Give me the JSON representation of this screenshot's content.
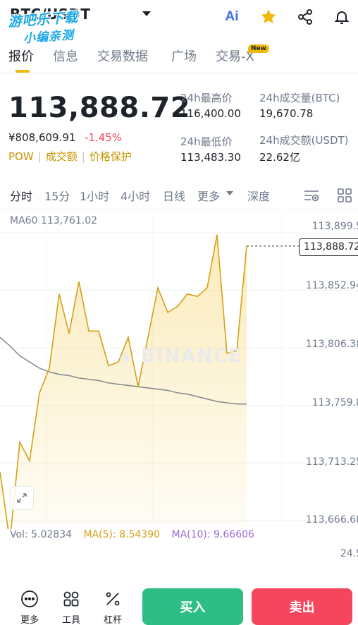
{
  "header": {
    "pair": "BTC/USDT",
    "watermark_line1": "游吧乐下载",
    "watermark_line2": "小编亲测",
    "ai_label": "Ai"
  },
  "tabs": [
    {
      "label": "报价",
      "active": true
    },
    {
      "label": "信息",
      "active": false
    },
    {
      "label": "交易数据",
      "active": false
    },
    {
      "label": "广场",
      "active": false
    },
    {
      "label": "交易-X",
      "active": false,
      "badge": "New"
    }
  ],
  "quote": {
    "last_price": "113,888.72",
    "cny_price": "¥808,609.91",
    "change_pct": "-1.45%",
    "tags": [
      "POW",
      "成交额",
      "价格保护"
    ]
  },
  "stats": {
    "high_label": "24h最高价",
    "high_value": "116,400.00",
    "vol_btc_label": "24h成交量(BTC)",
    "vol_btc_value": "19,670.78",
    "low_label": "24h最低价",
    "low_value": "113,483.30",
    "vol_usdt_label": "24h成交额(USDT)",
    "vol_usdt_value": "22.62亿"
  },
  "intervals": [
    {
      "label": "分时",
      "active": true
    },
    {
      "label": "15分",
      "active": false
    },
    {
      "label": "1小时",
      "active": false
    },
    {
      "label": "4小时",
      "active": false
    },
    {
      "label": "日线",
      "active": false
    },
    {
      "label": "更多",
      "active": false
    },
    {
      "label": "深度",
      "active": false
    }
  ],
  "chart": {
    "ma60_label": "MA60 113,761.02",
    "y_ticks": [
      "113,899.5",
      "113,852.94",
      "113,806.38",
      "113,759.8",
      "113,713.25",
      "113,666.68"
    ],
    "last_price_tag": "113,888.72",
    "watermark": "BINANCE",
    "colors": {
      "line": "#d4a017",
      "fill": "#f0b90b",
      "ma": "#8a8d91",
      "up": "#2ebd85",
      "down": "#f6465d"
    }
  },
  "chart_data": {
    "type": "line",
    "ylim": [
      113666.68,
      113899.5
    ],
    "y_ticks": [
      113899.5,
      113852.94,
      113806.38,
      113759.8,
      113713.25,
      113666.68
    ],
    "price": [
      113706,
      113650,
      113730,
      113715,
      113770,
      113790,
      113850,
      113818,
      113860,
      113820,
      113820,
      113792,
      113795,
      113815,
      113775,
      113815,
      113855,
      113835,
      113840,
      113850,
      113848,
      113855,
      113898,
      113802,
      113804,
      113888.72
    ],
    "ma60": [
      113815,
      113808,
      113800,
      113795,
      113790,
      113787,
      113785,
      113784,
      113782,
      113781,
      113780,
      113778,
      113777,
      113776,
      113775,
      113774,
      113773,
      113772,
      113770,
      113769,
      113767,
      113765,
      113763,
      113762,
      113761,
      113761.02
    ],
    "volume_readout": {
      "vol": "Vol: 5.02834",
      "ma5": "MA(5): 8.54390",
      "ma10": "MA(10): 9.66606",
      "axis_top": "24.5"
    }
  },
  "bottom": {
    "more_label": "更多",
    "tools_label": "工具",
    "leverage_label": "杠杆",
    "buy_label": "买入",
    "sell_label": "卖出"
  }
}
